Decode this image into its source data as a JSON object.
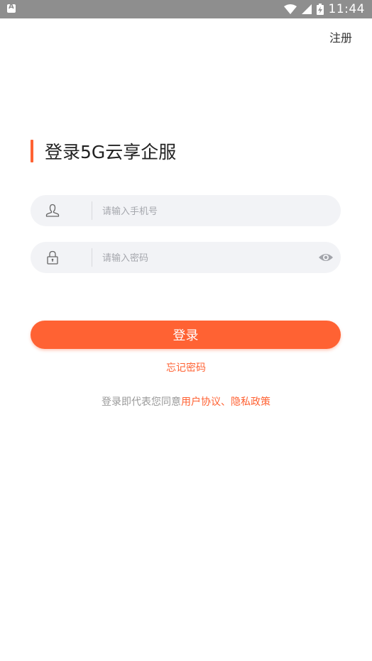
{
  "status_bar": {
    "time": "11:44",
    "app_icon": "A",
    "icons": [
      "wifi-icon",
      "signal-icon",
      "battery-charging-icon"
    ]
  },
  "header": {
    "register_label": "注册"
  },
  "title": "登录5G云享企服",
  "phone_field": {
    "placeholder": "请输入手机号",
    "value": "",
    "icon": "user-icon"
  },
  "password_field": {
    "placeholder": "请输入密码",
    "value": "",
    "icon": "lock-icon",
    "toggle_icon": "eye-icon"
  },
  "login_button": {
    "label": "登录"
  },
  "forgot_password": {
    "label": "忘记密码"
  },
  "agreement": {
    "prefix": "登录即代表您同意",
    "link": "用户协议、隐私政策"
  },
  "colors": {
    "accent": "#ff6233",
    "field_bg": "#f2f3f6",
    "status_bar": "#8e8e8e",
    "hint_text": "#999999"
  }
}
